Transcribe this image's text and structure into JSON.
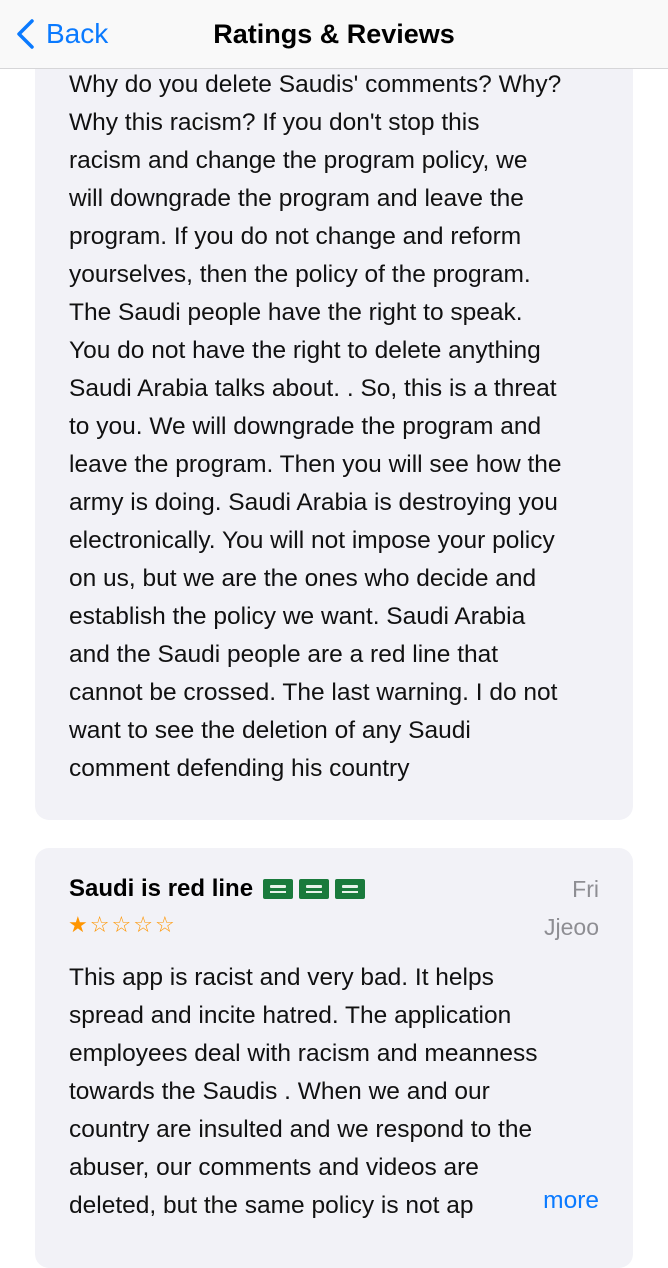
{
  "nav": {
    "back_label": "Back",
    "title": "Ratings & Reviews"
  },
  "reviews": [
    {
      "body_lines": [
        "Why do you delete Saudis' comments? Why?",
        "Why this racism? If you don't stop this",
        "racism and change the program policy, we",
        "will downgrade the program and leave the",
        "program. If you do not change and reform",
        "yourselves, then the policy of the program.",
        "The Saudi people have the right to speak.",
        "You do not have the right to delete anything",
        "Saudi Arabia talks about. . So, this is a threat",
        "to you. We will downgrade the program and",
        "leave the program. Then you will see how the",
        "army is doing. Saudi Arabia is destroying you",
        "electronically. You will not impose your policy",
        "on us, but we are the ones who decide and",
        "establish the policy we want. Saudi Arabia",
        "and the Saudi people are a red line that",
        "cannot be crossed. The last warning. I do not",
        "want to see the deletion of any Saudi",
        "comment defending his country"
      ]
    },
    {
      "title": "Saudi is red line",
      "flag_emoji": [
        "saudi-flag",
        "saudi-flag",
        "saudi-flag"
      ],
      "rating": 1,
      "rating_max": 5,
      "date": "Fri",
      "author": "Jjeoo",
      "body_lines": [
        "This app is racist and very bad. It helps",
        "spread and incite hatred. The application",
        "employees deal with racism and meanness",
        "towards the Saudis . When we and our",
        "country are insulted and we respond to the",
        "abuser, our comments and videos are",
        "deleted, but the same policy is not ap"
      ],
      "more_label": "more"
    }
  ],
  "colors": {
    "accent": "#0a7aff",
    "card_bg": "#f2f2f7",
    "star": "#ff9500",
    "meta": "#8e8e93"
  }
}
